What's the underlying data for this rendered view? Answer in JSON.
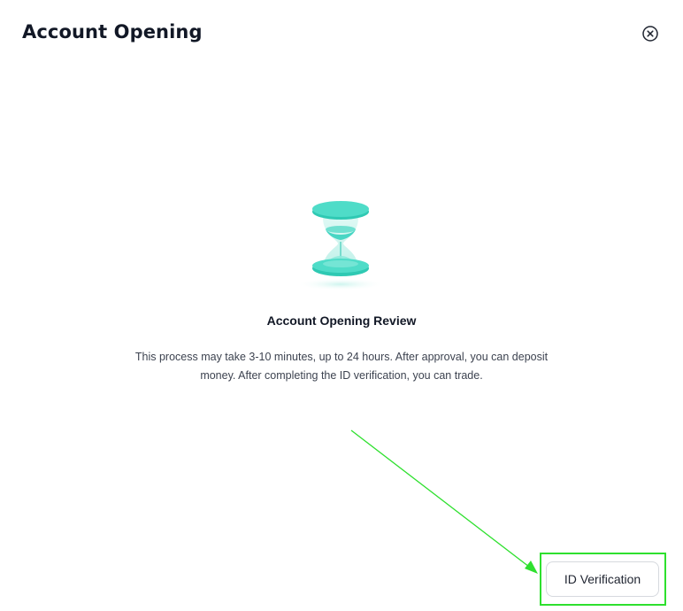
{
  "dialog": {
    "title": "Account Opening"
  },
  "icons": {
    "close": "close-circle-icon",
    "illustration": "hourglass-icon"
  },
  "review": {
    "title": "Account Opening Review",
    "description": "This process may take 3-10 minutes, up to 24 hours. After approval, you can deposit money. After completing the ID verification, you can trade."
  },
  "actions": {
    "id_verification_label": "ID Verification"
  },
  "colors": {
    "accent": "#3fd4c2",
    "annotation": "#2ee02e",
    "title_text": "#121826",
    "body_text": "#3d4350"
  }
}
